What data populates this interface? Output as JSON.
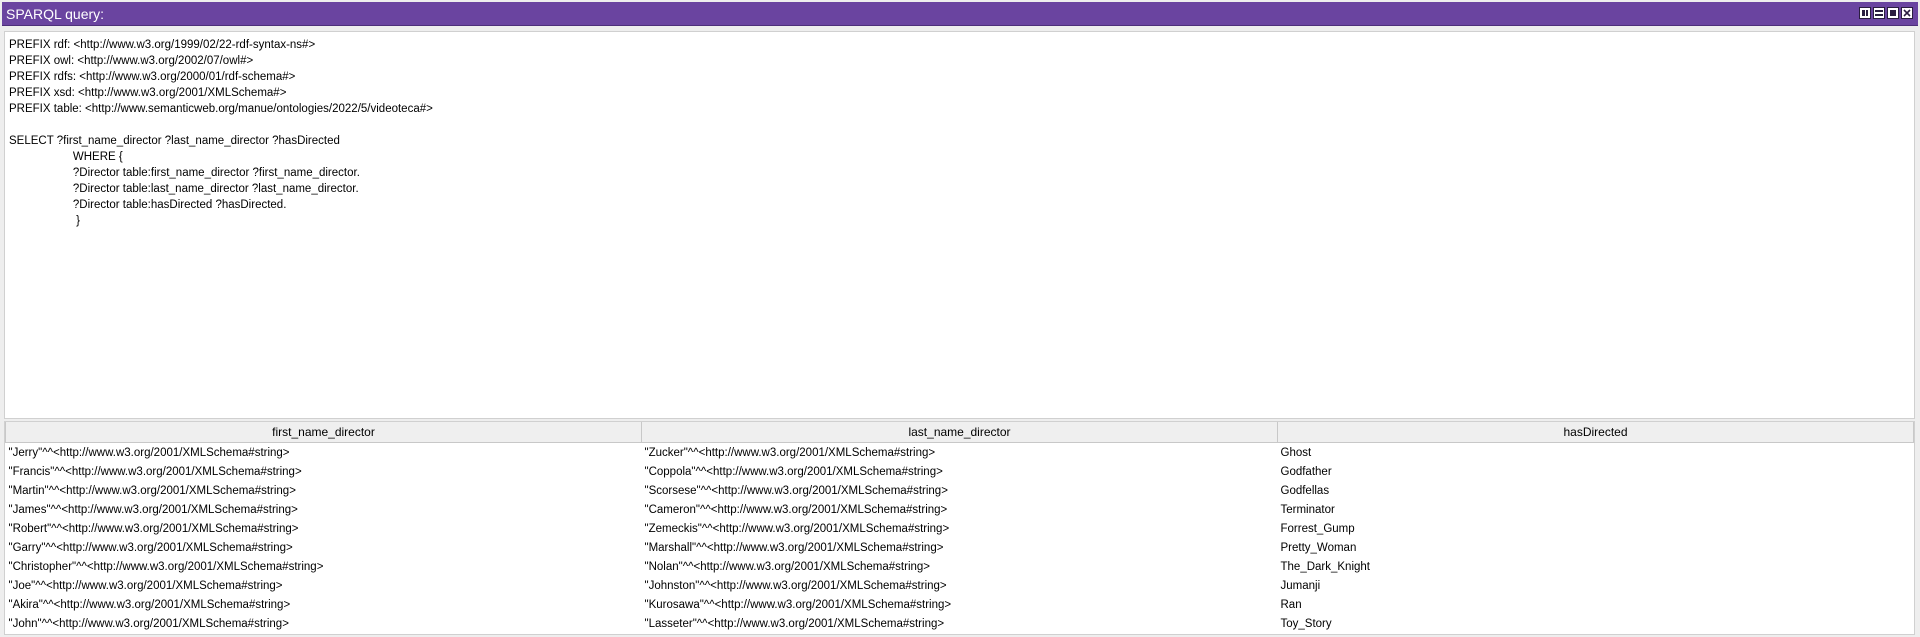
{
  "window": {
    "title": "SPARQL query:",
    "controls": [
      "split-view-icon",
      "restore-icon",
      "maximize-icon",
      "close-icon"
    ]
  },
  "query": {
    "text": "PREFIX rdf: <http://www.w3.org/1999/02/22-rdf-syntax-ns#>\nPREFIX owl: <http://www.w3.org/2002/07/owl#>\nPREFIX rdfs: <http://www.w3.org/2000/01/rdf-schema#>\nPREFIX xsd: <http://www.w3.org/2001/XMLSchema#>\nPREFIX table: <http://www.semanticweb.org/manue/ontologies/2022/5/videoteca#>\n\nSELECT ?first_name_director ?last_name_director ?hasDirected\n                    WHERE {\n                    ?Director table:first_name_director ?first_name_director.\n                    ?Director table:last_name_director ?last_name_director.\n                    ?Director table:hasDirected ?hasDirected.\n                     }"
  },
  "results": {
    "columns": [
      "first_name_director",
      "last_name_director",
      "hasDirected"
    ],
    "rows": [
      [
        "\"Jerry\"^^<http://www.w3.org/2001/XMLSchema#string>",
        "\"Zucker\"^^<http://www.w3.org/2001/XMLSchema#string>",
        "Ghost"
      ],
      [
        "\"Francis\"^^<http://www.w3.org/2001/XMLSchema#string>",
        "\"Coppola\"^^<http://www.w3.org/2001/XMLSchema#string>",
        "Godfather"
      ],
      [
        "\"Martin\"^^<http://www.w3.org/2001/XMLSchema#string>",
        "\"Scorsese\"^^<http://www.w3.org/2001/XMLSchema#string>",
        "Godfellas"
      ],
      [
        "\"James\"^^<http://www.w3.org/2001/XMLSchema#string>",
        "\"Cameron\"^^<http://www.w3.org/2001/XMLSchema#string>",
        "Terminator"
      ],
      [
        "\"Robert\"^^<http://www.w3.org/2001/XMLSchema#string>",
        "\"Zemeckis\"^^<http://www.w3.org/2001/XMLSchema#string>",
        "Forrest_Gump"
      ],
      [
        "\"Garry\"^^<http://www.w3.org/2001/XMLSchema#string>",
        "\"Marshall\"^^<http://www.w3.org/2001/XMLSchema#string>",
        "Pretty_Woman"
      ],
      [
        "\"Christopher\"^^<http://www.w3.org/2001/XMLSchema#string>",
        "\"Nolan\"^^<http://www.w3.org/2001/XMLSchema#string>",
        "The_Dark_Knight"
      ],
      [
        "\"Joe\"^^<http://www.w3.org/2001/XMLSchema#string>",
        "\"Johnston\"^^<http://www.w3.org/2001/XMLSchema#string>",
        "Jumanji"
      ],
      [
        "\"Akira\"^^<http://www.w3.org/2001/XMLSchema#string>",
        "\"Kurosawa\"^^<http://www.w3.org/2001/XMLSchema#string>",
        "Ran"
      ],
      [
        "\"John\"^^<http://www.w3.org/2001/XMLSchema#string>",
        "\"Lasseter\"^^<http://www.w3.org/2001/XMLSchema#string>",
        "Toy_Story"
      ]
    ]
  },
  "colors": {
    "titlebar_bg": "#6a44a0",
    "titlebar_text": "#ffffff",
    "panel_bg": "#ffffff",
    "window_bg": "#eeeeee"
  }
}
